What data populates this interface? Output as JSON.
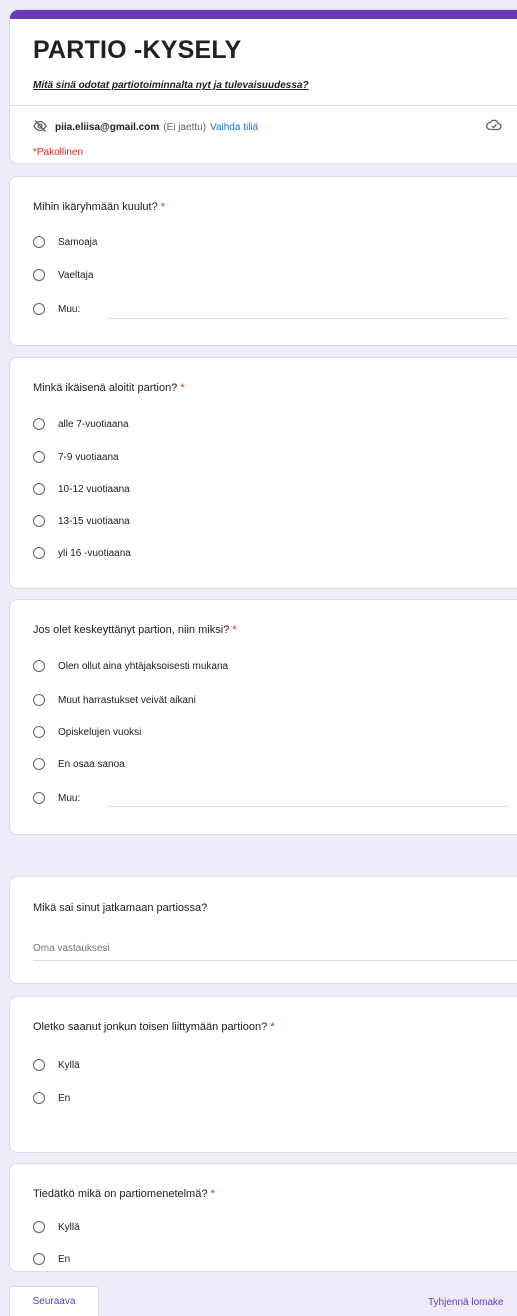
{
  "form": {
    "title": "PARTIO -KYSELY",
    "description": "Mitä sinä odotat partiotoiminnalta nyt ja tulevaisuudessa?",
    "account_email": "piia.eliisa@gmail.com",
    "account_shared": "(Ei jaettu)",
    "switch_account": "Vaihda tiliä",
    "required_note": "*Pakollinen"
  },
  "icons": {
    "hidden": "eye-off-icon",
    "cloud": "cloud-saved-icon"
  },
  "colors": {
    "accent": "#673ab7",
    "required": "#d93025",
    "link": "#1a73e8",
    "background": "#f0ebf8"
  },
  "questions": [
    {
      "title": "Mihin ikäryhmään kuulut?",
      "required": "*",
      "options": [
        "Samoaja",
        "Vaeltaja",
        "Muu:"
      ]
    },
    {
      "title": "Minkä ikäisenä aloitit partion?",
      "required": "*",
      "options": [
        "alle 7-vuotiaana",
        "7-9 vuotiaana",
        "10-12 vuotiaana",
        "13-15 vuotiaana",
        "yli 16 -vuotiaana"
      ]
    },
    {
      "title": "Jos olet keskeyttänyt partion, niin miksi?",
      "required": "*",
      "options": [
        "Olen ollut aina yhtäjaksoisesti mukana",
        "Muut harrastukset veivät aikani",
        "Opiskelujen vuoksi",
        "En osaa sanoa",
        "Muu:"
      ]
    },
    {
      "title": "Mikä sai sinut jatkamaan partiossa?",
      "placeholder": "Oma vastauksesi"
    },
    {
      "title": "Oletko saanut jonkun toisen liittymään partioon?",
      "required": "*",
      "options": [
        "Kyllä",
        "En"
      ]
    },
    {
      "title": "Tiedätkö mikä on partiomenetelmä?",
      "required": "*",
      "options": [
        "Kyllä",
        "En"
      ]
    }
  ],
  "footer": {
    "next_label": "Seuraava",
    "clear_label": "Tyhjennä lomake"
  }
}
